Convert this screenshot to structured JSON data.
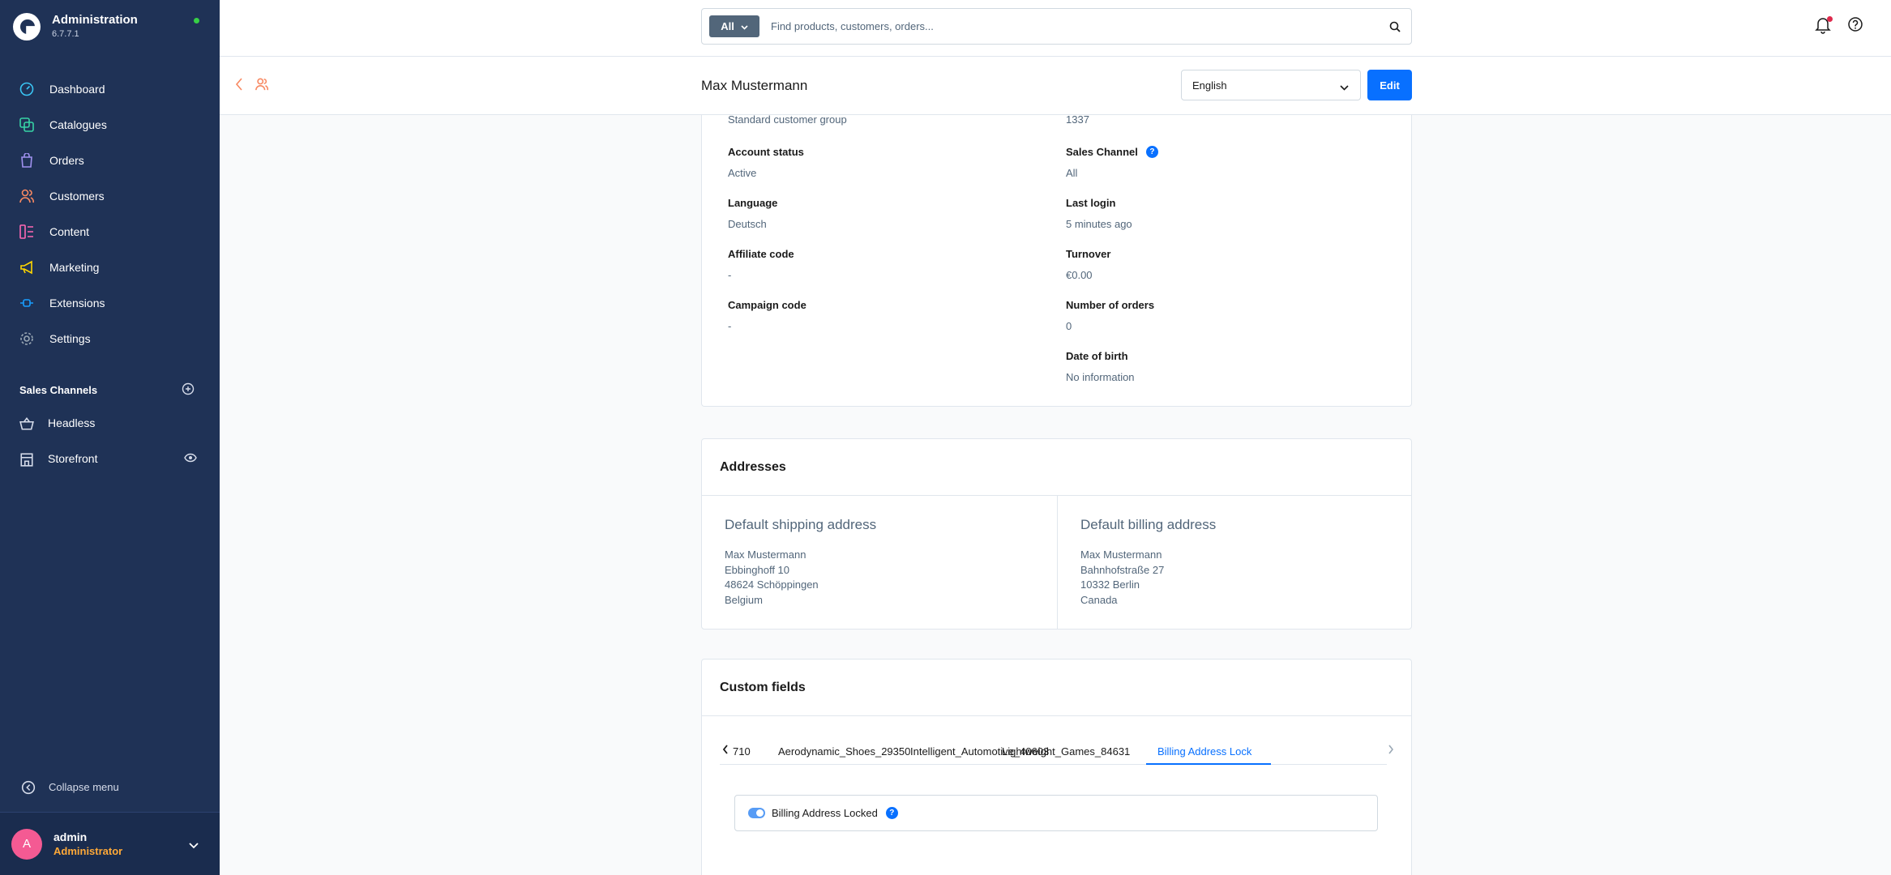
{
  "app": {
    "title": "Administration",
    "version": "6.7.7.1"
  },
  "sidebar": {
    "nav": [
      {
        "label": "Dashboard",
        "icon": "dashboard-icon",
        "color": "#3ac5f4"
      },
      {
        "label": "Catalogues",
        "icon": "catalogue-icon",
        "color": "#37d3a5"
      },
      {
        "label": "Orders",
        "icon": "orders-icon",
        "color": "#a092f0"
      },
      {
        "label": "Customers",
        "icon": "customers-icon",
        "color": "#f88962"
      },
      {
        "label": "Content",
        "icon": "content-icon",
        "color": "#ff68b4"
      },
      {
        "label": "Marketing",
        "icon": "marketing-icon",
        "color": "#ffd700"
      },
      {
        "label": "Extensions",
        "icon": "extensions-icon",
        "color": "#189eff"
      },
      {
        "label": "Settings",
        "icon": "settings-icon",
        "color": "#9aa8b5"
      }
    ],
    "sales_channels_title": "Sales Channels",
    "sales_channels": [
      {
        "label": "Headless",
        "icon": "basket-icon"
      },
      {
        "label": "Storefront",
        "icon": "storefront-icon"
      }
    ],
    "collapse_label": "Collapse menu",
    "user": {
      "initial": "A",
      "name": "admin",
      "role": "Administrator"
    }
  },
  "topbar": {
    "search_type": "All",
    "search_placeholder": "Find products, customers, orders..."
  },
  "smartbar": {
    "title": "Max Mustermann",
    "language": "English",
    "edit_label": "Edit"
  },
  "customer_info": {
    "left": [
      {
        "label": "",
        "value": "Standard customer group"
      },
      {
        "label": "Account status",
        "value": "Active"
      },
      {
        "label": "Language",
        "value": "Deutsch"
      },
      {
        "label": "Affiliate code",
        "value": "-"
      },
      {
        "label": "Campaign code",
        "value": "-"
      }
    ],
    "right": [
      {
        "label": "",
        "value": "1337"
      },
      {
        "label": "Sales Channel",
        "value": "All"
      },
      {
        "label": "Last login",
        "value": "5 minutes ago"
      },
      {
        "label": "Turnover",
        "value": "€0.00"
      },
      {
        "label": "Number of orders",
        "value": "0"
      },
      {
        "label": "Date of birth",
        "value": "No information"
      }
    ]
  },
  "addresses": {
    "title": "Addresses",
    "shipping": {
      "title": "Default shipping address",
      "lines": [
        "Max Mustermann",
        "Ebbinghoff 10",
        "48624 Schöppingen",
        "Belgium"
      ]
    },
    "billing": {
      "title": "Default billing address",
      "lines": [
        "Max Mustermann",
        "Bahnhofstraße 27",
        "10332 Berlin",
        "Canada"
      ]
    }
  },
  "custom_fields": {
    "title": "Custom fields",
    "tabs": [
      "710",
      "Aerodynamic_Shoes_29350",
      "Intelligent_Automotive_40603",
      "Lightweight_Games_84631",
      "Billing Address Lock"
    ],
    "active_tab": "Billing Address Lock",
    "switch_label": "Billing Address Locked",
    "switch_on": true
  },
  "colors": {
    "sidebar_bg": "#1f3256",
    "primary": "#0870ff",
    "accent_customer": "#f88962",
    "role": "#ffa938"
  }
}
